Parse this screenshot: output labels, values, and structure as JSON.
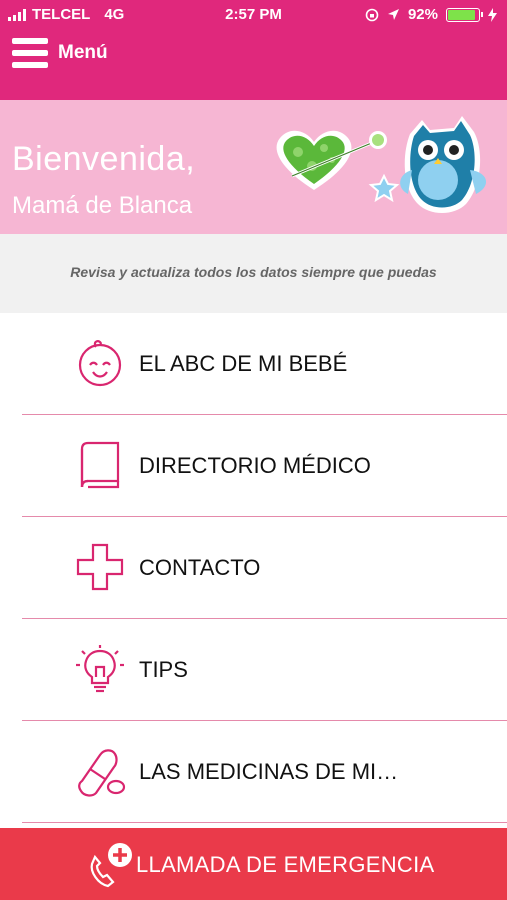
{
  "status_bar": {
    "carrier": "TELCEL",
    "network": "4G",
    "time": "2:57 PM",
    "battery_percent": "92%",
    "battery_level": 0.92
  },
  "header": {
    "menu_label": "Menú",
    "menu_icon": "hamburger-icon",
    "color": "#e0287c"
  },
  "welcome": {
    "greeting": "Bienvenida,",
    "name": "Mamá de Blanca",
    "banner_color": "#f6b6d3"
  },
  "subtitle": "Revisa y actualiza todos los datos siempre que puedas",
  "menu_items": [
    {
      "label": "EL ABC DE MI BEBÉ",
      "icon": "baby-face-icon"
    },
    {
      "label": "DIRECTORIO MÉDICO",
      "icon": "book-icon"
    },
    {
      "label": "CONTACTO",
      "icon": "medical-cross-icon"
    },
    {
      "label": "TIPS",
      "icon": "lightbulb-icon"
    },
    {
      "label": "LAS MEDICINAS DE MI…",
      "icon": "pill-icon"
    }
  ],
  "emergency": {
    "label": "LLAMADA DE EMERGENCIA",
    "icon": "phone-plus-icon",
    "color": "#ea3a4a"
  },
  "colors": {
    "accent": "#e0287c",
    "icon_stroke": "#d9266f",
    "divider": "#e58aab"
  }
}
